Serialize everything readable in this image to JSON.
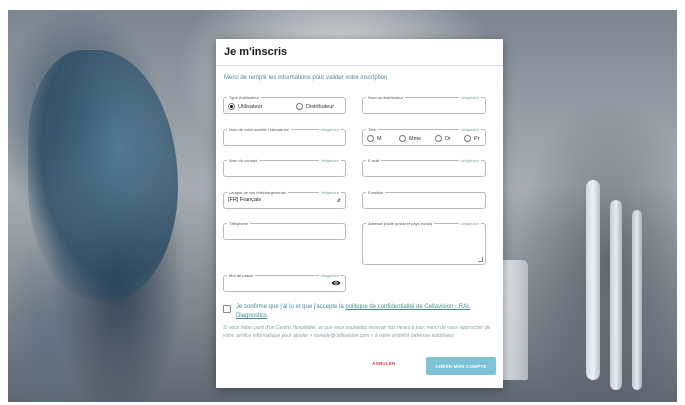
{
  "modal": {
    "title": "Je m'inscris",
    "subtitle": "Merci de remplir les informations pour valider votre inscription"
  },
  "form": {
    "user_type": {
      "label": "Type d'utilisateur",
      "options": [
        "Utilisateur",
        "Distributeur"
      ],
      "selected": "Utilisateur"
    },
    "distributor_name": {
      "label": "Nom du distributeur",
      "required": "obligatoire",
      "value": ""
    },
    "company_name": {
      "label": "Nom de votre société / laboratoire",
      "required": "obligatoire",
      "value": ""
    },
    "title": {
      "label": "Titre",
      "required": "obligatoire",
      "options": [
        "M",
        "Mme",
        "Dr",
        "Pr"
      ]
    },
    "contact_name": {
      "label": "Nom du contact",
      "required": "obligatoire",
      "value": ""
    },
    "email": {
      "label": "E-mail",
      "required": "obligatoire",
      "value": ""
    },
    "download_language": {
      "label": "Langue de vos téléchargements",
      "required": "obligatoire",
      "value": "[FR] Français"
    },
    "function": {
      "label": "Fonction",
      "value": ""
    },
    "phone": {
      "label": "Téléphone",
      "value": ""
    },
    "address": {
      "label": "Adresse (code postal et pays inclus)",
      "required": "obligatoire",
      "value": ""
    },
    "password": {
      "label": "Mot de passe",
      "required": "obligatoire",
      "value": ""
    }
  },
  "consent": {
    "text": "Je confirme que j'ai lu et que j'accepte la",
    "link": "politique de confidentialité de Cellavision - RAL Diagnostics"
  },
  "note": "Si vous faites parti d'un Centre Hospitalier, et que vous souhaitez recevoir nos mises à jour, merci de vous rapprocher de votre service informatique pour ajouter « noreply@cellavision.com » à votre whitelist (adresse autorisée).",
  "buttons": {
    "cancel": "ANNULER",
    "create": "CRÉER MON COMPTE"
  },
  "colors": {
    "accent": "#4a8a95",
    "primary_button": "#7fc3d6",
    "cancel": "#e23b3b"
  }
}
